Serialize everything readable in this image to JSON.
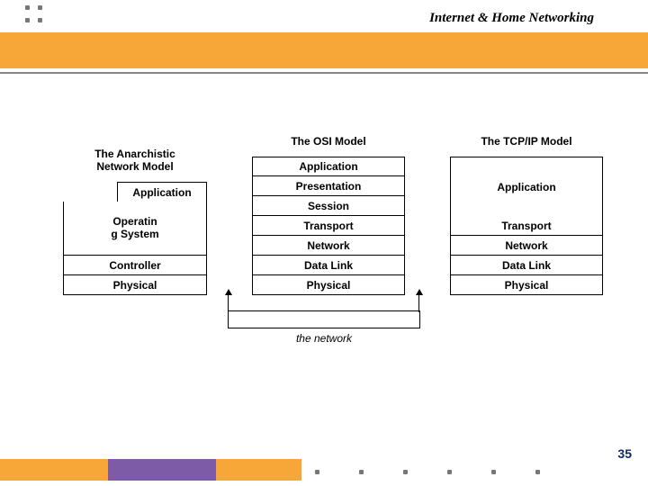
{
  "header": {
    "title": "Internet & Home Networking"
  },
  "columns": {
    "anarch": {
      "title": "The Anarchistic\nNetwork Model",
      "rows": {
        "app": "Application",
        "os": "Operatin\ng System",
        "controller": "Controller",
        "physical": "Physical"
      }
    },
    "osi": {
      "title": "The OSI Model",
      "rows": {
        "app": "Application",
        "pres": "Presentation",
        "sess": "Session",
        "trans": "Transport",
        "net": "Network",
        "dl": "Data Link",
        "phys": "Physical"
      }
    },
    "tcpip": {
      "title": "The TCP/IP Model",
      "rows": {
        "app": "Application",
        "trans": "Transport",
        "net": "Network",
        "dl": "Data Link",
        "phys": "Physical"
      }
    }
  },
  "network_label": "the network",
  "page_number": "35"
}
